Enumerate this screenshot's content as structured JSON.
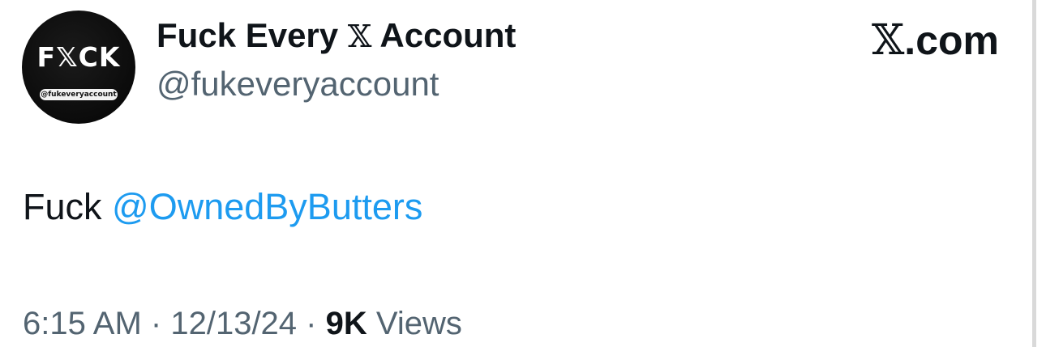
{
  "profile": {
    "avatar_logo": "F𝕏CK",
    "avatar_handle": "@fukeveryaccount",
    "display_name_before": "Fuck Every",
    "display_name_x": "𝕏",
    "display_name_after": "Account",
    "handle": "@fukeveryaccount"
  },
  "brand": {
    "x": "𝕏",
    "suffix": ".com"
  },
  "tweet": {
    "text": "Fuck",
    "mention": "@OwnedByButters"
  },
  "meta": {
    "time": "6:15 AM",
    "separator": "·",
    "date": "12/13/24",
    "views_count": "9K",
    "views_label": "Views"
  },
  "colors": {
    "text": "#0f1419",
    "secondary": "#536471",
    "link": "#1d9bf0"
  }
}
